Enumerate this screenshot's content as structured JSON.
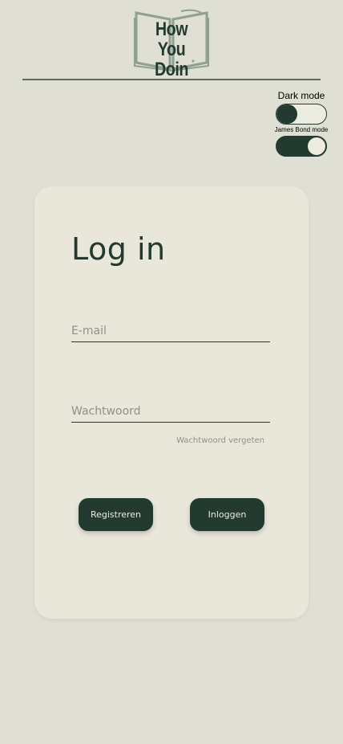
{
  "brand": {
    "line1": "How You",
    "line2": "Doin"
  },
  "toggles": {
    "dark_mode_label": "Dark mode",
    "bond_mode_label": "James Bond mode"
  },
  "login": {
    "title": "Log in",
    "email_placeholder": "E-mail",
    "password_placeholder": "Wachtwoord",
    "forgot_label": "Wachtwoord vergeten",
    "register_label": "Registreren",
    "login_label": "Inloggen"
  },
  "colors": {
    "background": "#dfdfd3",
    "card": "#e9e6da",
    "primary": "#223a30",
    "muted_text": "#8d9287"
  }
}
